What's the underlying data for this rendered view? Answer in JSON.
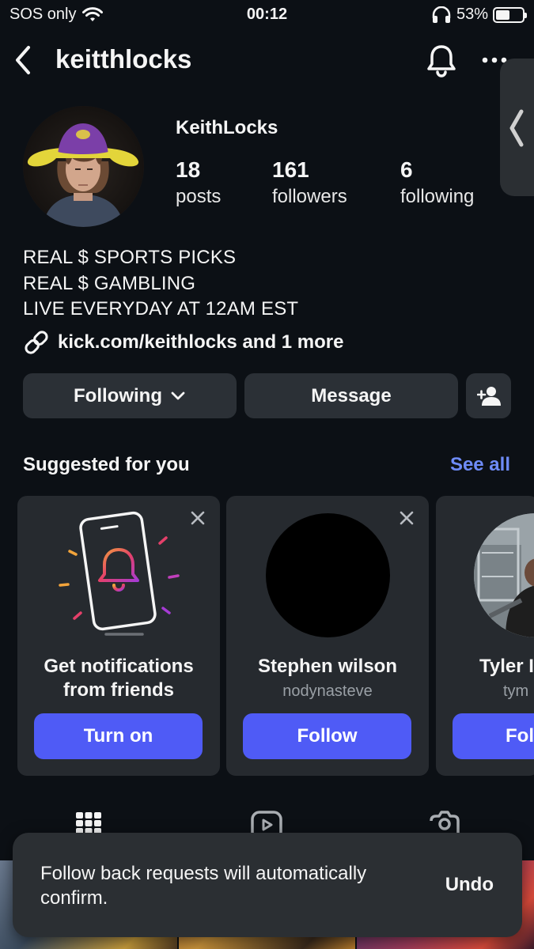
{
  "status_bar": {
    "carrier": "SOS only",
    "time": "00:12",
    "battery_percent": "53%",
    "battery_level": 0.53,
    "icons": [
      "wifi-icon",
      "headphones-icon",
      "battery-icon"
    ]
  },
  "nav": {
    "username": "keitthlocks",
    "icons": [
      "back-arrow-icon",
      "bell-icon",
      "more-dots-icon",
      "chevron-left-icon"
    ]
  },
  "profile": {
    "display_name": "KeithLocks",
    "stats": [
      {
        "num": "18",
        "label": "posts"
      },
      {
        "num": "161",
        "label": "followers"
      },
      {
        "num": "6",
        "label": "following"
      }
    ],
    "bio": [
      "REAL $ SPORTS PICKS",
      "REAL $ GAMBLING",
      "LIVE EVERYDAY AT 12AM EST"
    ],
    "link_text": "kick.com/keithlocks and 1 more"
  },
  "actions": {
    "following_label": "Following",
    "message_label": "Message"
  },
  "suggested": {
    "title": "Suggested for you",
    "see_all": "See all",
    "cards": [
      {
        "title_line1": "Get notifications",
        "title_line2": "from friends",
        "button": "Turn on"
      },
      {
        "title": "Stephen wilson",
        "handle": "nodynasteve",
        "button": "Follow"
      },
      {
        "title": "Tyler I",
        "handle": "tym",
        "button": "Fol"
      }
    ]
  },
  "toast": {
    "message": "Follow back requests will automatically confirm.",
    "undo": "Undo"
  },
  "colors": {
    "background": "#0c1015",
    "accent_blue": "#4f5bf6",
    "link_blue": "#6e8bf7",
    "card_bg": "#262a2f",
    "button_dark": "#2b3036"
  }
}
